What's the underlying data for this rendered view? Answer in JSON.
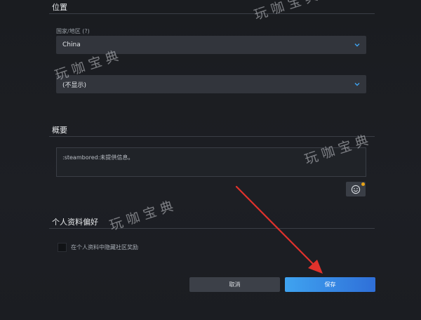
{
  "location": {
    "title": "位置",
    "country": {
      "label": "国家/地区 (?)",
      "value": "China"
    },
    "state": {
      "value": "(不显示)"
    }
  },
  "summary": {
    "title": "概要",
    "text": ":steambored:未提供信息。"
  },
  "preferences": {
    "title": "个人资料偏好",
    "hide_community_awards_label": "在个人资料中隐藏社区奖励"
  },
  "actions": {
    "cancel_label": "取消",
    "save_label": "保存"
  },
  "watermark": {
    "text": "玩咖宝典"
  },
  "colors": {
    "background": "#1b1d22",
    "accent_blue": "#3fa3f0",
    "annotation_arrow": "#e0322c",
    "notification_dot": "#e8a317"
  },
  "icons": {
    "dropdown": "chevron-down-icon",
    "emoji": "emoticon-icon"
  }
}
